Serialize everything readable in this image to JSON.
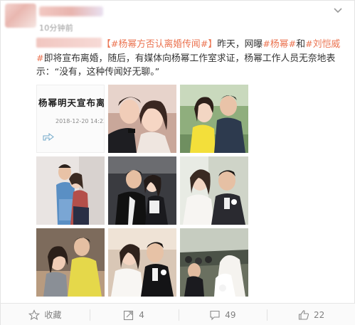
{
  "post": {
    "timestamp": "10分钟前",
    "text": {
      "topic": "【#杨幂方否认离婚传闻#】",
      "part1": "昨天，网曝",
      "tag1": "#杨幂#",
      "part2": "和",
      "tag2": "#刘恺威#",
      "part3": "即将宣布离婚，随后，有媒体向杨幂工作室求证，杨幂工作人员无奈地表示：“没有，这种传闻好无聊。”"
    },
    "image_1": {
      "headline": "杨幂明天宣布离",
      "date": "2018-12-20 14:22:46"
    }
  },
  "footer": {
    "favorite_label": "收藏",
    "repost_count": "4",
    "comment_count": "49",
    "like_count": "22"
  },
  "colors": {
    "topic": "#eb7350",
    "text": "#333333",
    "muted": "#808080"
  },
  "icons": [
    "more-icon",
    "share-icon",
    "star-icon",
    "repost-icon",
    "comment-icon",
    "thumbs-up-icon"
  ]
}
